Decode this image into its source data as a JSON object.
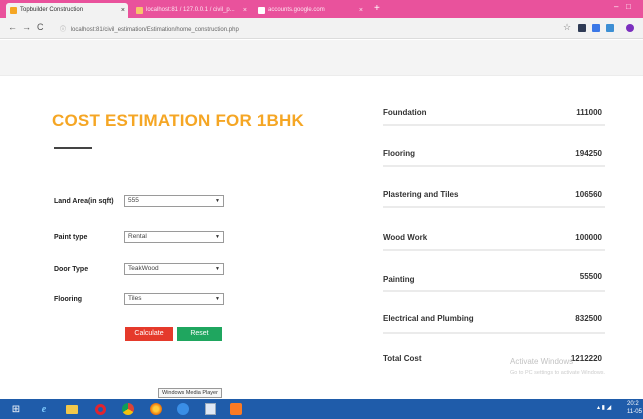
{
  "browser": {
    "tabs": [
      {
        "label": "Topbuilder Construction",
        "active": true
      },
      {
        "label": "localhost:81 / 127.0.0.1 / civil_p...",
        "active": false
      },
      {
        "label": "accounts.google.com",
        "active": false
      }
    ],
    "new_tab": "+",
    "minimize": "–",
    "maximize": "□",
    "back": "←",
    "forward": "→",
    "reload": "C",
    "info": "ⓘ",
    "url": "localhost:81/civil_estimation/Estimation/home_construction.php",
    "bookmark": "☆"
  },
  "page": {
    "heading": "COST ESTIMATION FOR 1BHK",
    "form": {
      "land_area": {
        "label": "Land Area(in sqft)",
        "value": "555"
      },
      "paint_type": {
        "label": "Paint type",
        "value": "Rental"
      },
      "door_type": {
        "label": "Door Type",
        "value": "TeakWood"
      },
      "flooring": {
        "label": "Flooring",
        "value": "Tiles"
      }
    },
    "calculate_label": "Calculate",
    "reset_label": "Reset",
    "results": [
      {
        "name": "Foundation",
        "value": "111000"
      },
      {
        "name": "Flooring",
        "value": "194250"
      },
      {
        "name": "Plastering and Tiles",
        "value": "106560"
      },
      {
        "name": "Wood Work",
        "value": "100000"
      },
      {
        "name": "Painting",
        "value": "55500"
      },
      {
        "name": "Electrical and Plumbing",
        "value": "832500"
      },
      {
        "name": "Total Cost",
        "value": "1212220"
      }
    ]
  },
  "watermark": {
    "line1": "Activate Windows",
    "line2": "Go to PC settings to activate Windows."
  },
  "tooltip": "Windows Media Player",
  "taskbar": {
    "time": "20:2",
    "date": "11-05",
    "start": "⊞"
  },
  "colors": {
    "accent": "#f5a624",
    "tab_strip": "#e9529c",
    "calculate": "#e53a2b",
    "reset": "#1fa65f",
    "taskbar": "#1f5caa"
  }
}
